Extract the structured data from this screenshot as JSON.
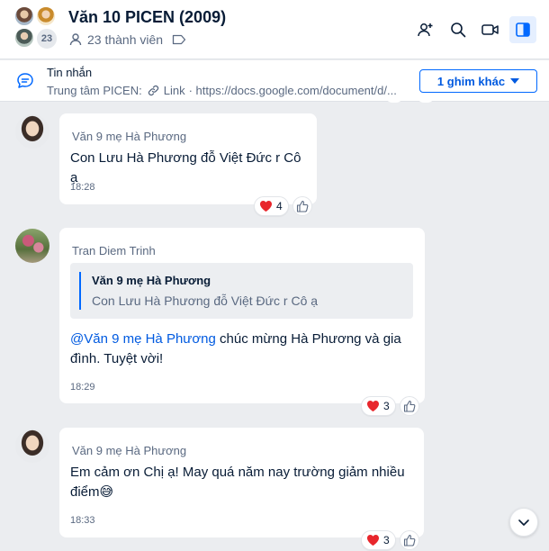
{
  "header": {
    "title": "Văn 10 PICEN (2009)",
    "member_count_badge": "23",
    "members_label": "23 thành viên",
    "icons": [
      "add-member-icon",
      "search-icon",
      "video-call-icon",
      "sidebar-toggle-icon"
    ]
  },
  "pinned": {
    "title": "Tin nhắn",
    "sender": "Trung tâm PICEN:",
    "link_label": "Link",
    "link_url": "· https://docs.google.com/document/d/...",
    "more_button": "1 ghim khác"
  },
  "messages": [
    {
      "sender": "Văn 9 mẹ Hà Phương",
      "text": "Con Lưu Hà Phương đỗ Việt Đức r Cô ạ",
      "time": "18:28",
      "reaction_count": "4"
    },
    {
      "sender": "Tran Diem Trinh",
      "quote_author": "Văn 9 mẹ Hà Phương",
      "quote_text": "Con Lưu Hà Phương đỗ Việt Đức r Cô ạ",
      "mention": "@Văn 9 mẹ Hà Phương",
      "text": " chúc mừng Hà Phương và gia đình. Tuyệt vời!",
      "time": "18:29",
      "reaction_count": "3"
    },
    {
      "sender": "Văn 9 mẹ Hà Phương",
      "text": "Em cảm ơn Chị ạ! May quá năm nay trường giảm nhiều điểm😅",
      "time": "18:33",
      "reaction_count": "3"
    }
  ],
  "colors": {
    "accent": "#0068ff",
    "heart": "#e8262c",
    "background": "#ebedf0"
  }
}
